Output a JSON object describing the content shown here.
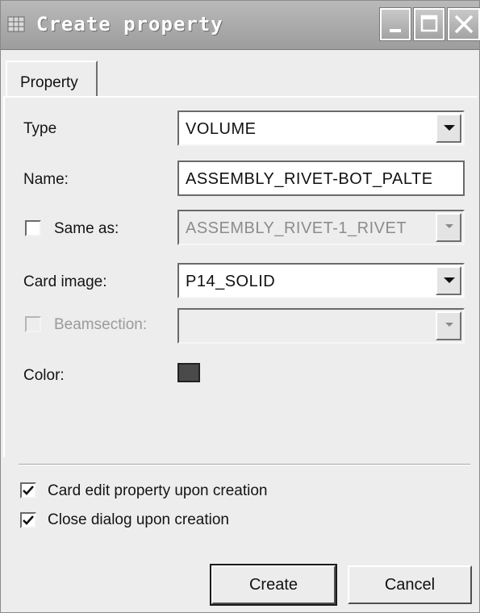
{
  "window": {
    "title": "Create property",
    "controls": [
      "minimize-icon",
      "maximize-icon",
      "close-icon"
    ]
  },
  "tabs": [
    {
      "label": "Property",
      "active": true
    }
  ],
  "form": {
    "type": {
      "label": "Type",
      "value": "VOLUME"
    },
    "name": {
      "label": "Name:",
      "value": "ASSEMBLY_RIVET-BOT_PALTE"
    },
    "same_as": {
      "label": "Same as:",
      "checked": false,
      "value": "ASSEMBLY_RIVET-1_RIVET",
      "enabled": false
    },
    "card_image": {
      "label": "Card image:",
      "value": "P14_SOLID"
    },
    "beamsection": {
      "label": "Beamsection:",
      "checked": false,
      "value": "",
      "enabled": false
    },
    "color": {
      "label": "Color:",
      "value": "#4a4a4a"
    }
  },
  "options": [
    {
      "label": "Card edit property upon creation",
      "checked": true
    },
    {
      "label": "Close dialog upon creation",
      "checked": true
    }
  ],
  "buttons": {
    "create": "Create",
    "cancel": "Cancel"
  }
}
